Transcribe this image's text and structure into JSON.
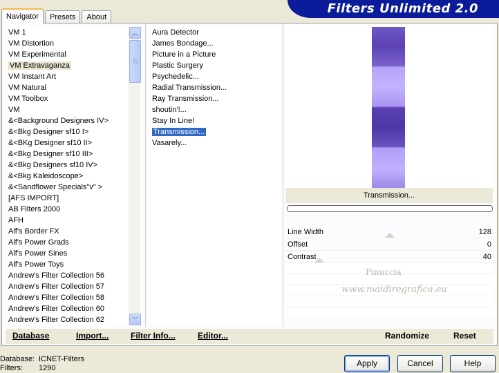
{
  "banner": {
    "title": "Filters Unlimited 2.0"
  },
  "tabs": [
    "Navigator",
    "Presets",
    "About"
  ],
  "categories": [
    "VM 1",
    "VM Distortion",
    "VM Experimental",
    "VM Extravaganza",
    "VM Instant Art",
    "VM Natural",
    "VM Toolbox",
    "VM",
    "&<Background Designers IV>",
    "&<Bkg Designer sf10 I>",
    "&<BKg Designer sf10 II>",
    "&<Bkg Designer sf10 III>",
    "&<Bkg Designers sf10 IV>",
    "&<Bkg Kaleidoscope>",
    "&<Sandflower Specials\"v\" >",
    "[AFS IMPORT]",
    "AB Filters 2000",
    "AFH",
    "Alf's Border FX",
    "Alf's Power Grads",
    "Alf's Power Sines",
    "Alf's Power Toys",
    "Andrew's Filter Collection 56",
    "Andrew's Filter Collection 57",
    "Andrew's Filter Collection 58",
    "Andrew's Filter Collection 60",
    "Andrew's Filter Collection 62"
  ],
  "selected_category": "VM Extravaganza",
  "filters": [
    "Aura Detector",
    "James Bondage...",
    "Picture in a Picture",
    "Plastic Surgery",
    "Psychedelic...",
    "Radial Transmission...",
    "Ray Transmission...",
    "shoutin'!...",
    "Stay In Line!",
    "Transmission...",
    "Vasarely..."
  ],
  "selected_filter": "Transmission...",
  "preview": {
    "filter_name": "Transmission..."
  },
  "params": [
    {
      "name": "Line Width",
      "value": "128"
    },
    {
      "name": "Offset",
      "value": "0"
    },
    {
      "name": "Contrast",
      "value": "40"
    }
  ],
  "watermark": {
    "line1": "Pinuccia",
    "line2": "www.maidiregrafica.eu"
  },
  "bottom_links": {
    "database": "Database",
    "import": "Import...",
    "filter_info": "Filter Info...",
    "editor": "Editor...",
    "randomize": "Randomize",
    "reset": "Reset"
  },
  "status": {
    "database_label": "Database:",
    "database_value": "ICNET-Filters",
    "filters_label": "Filters:",
    "filters_value": "1290"
  },
  "buttons": {
    "apply": "Apply",
    "cancel": "Cancel",
    "help": "Help"
  },
  "colors": {
    "banner": "#0a1c9a",
    "selection": "#316ac5",
    "preview_purple": "#6e58c4"
  }
}
